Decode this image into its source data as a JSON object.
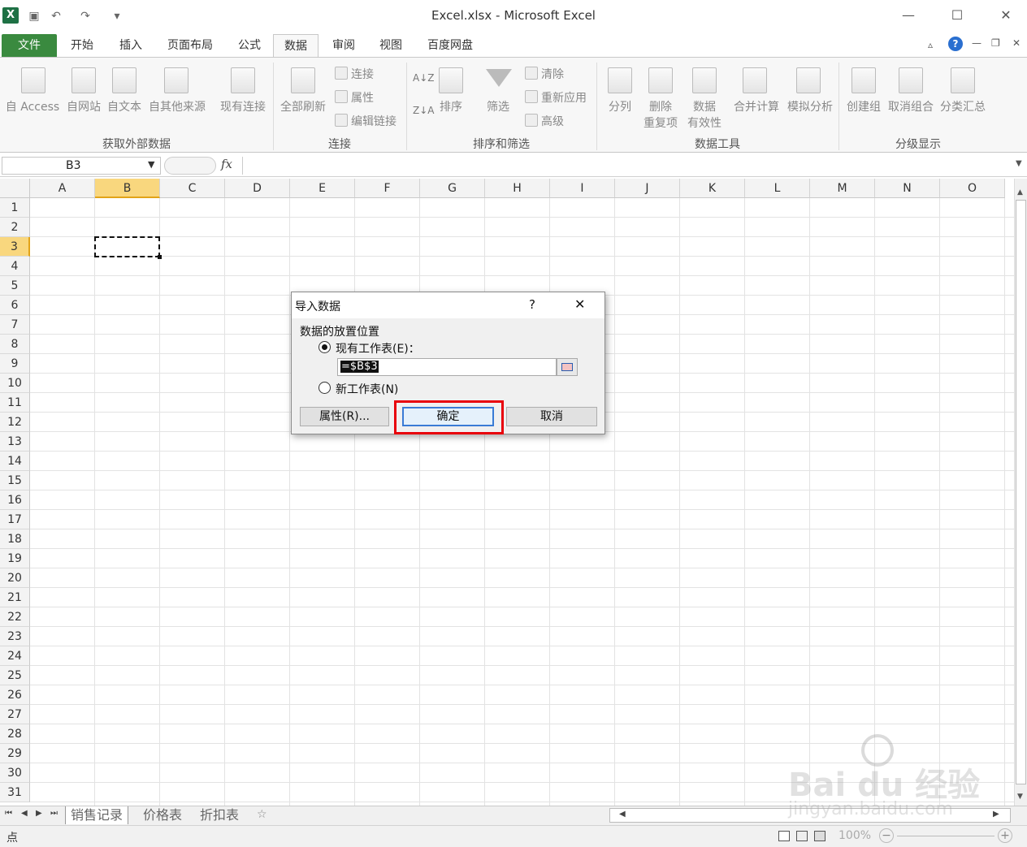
{
  "window": {
    "title": "Excel.xlsx - Microsoft Excel"
  },
  "quick_access": [
    "save-icon",
    "undo-icon",
    "redo-icon",
    "customize-icon"
  ],
  "tabs": [
    "文件",
    "开始",
    "插入",
    "页面布局",
    "公式",
    "数据",
    "审阅",
    "视图",
    "百度网盘"
  ],
  "active_tab": "数据",
  "ribbon": {
    "groups": [
      {
        "label": "获取外部数据",
        "buttons": [
          "自 Access",
          "自网站",
          "自文本",
          "自其他来源",
          "现有连接"
        ]
      },
      {
        "label": "连接",
        "buttons": [
          "全部刷新"
        ],
        "small": [
          "连接",
          "属性",
          "编辑链接"
        ]
      },
      {
        "label": "排序和筛选",
        "buttons": [
          "排序",
          "筛选"
        ],
        "small": [
          "清除",
          "重新应用",
          "高级"
        ]
      },
      {
        "label": "数据工具",
        "buttons": [
          "分列",
          "删除",
          "重复项",
          "数据",
          "有效性",
          "合并计算",
          "模拟分析"
        ]
      },
      {
        "label": "分级显示",
        "buttons": [
          "创建组",
          "取消组合",
          "分类汇总"
        ]
      }
    ]
  },
  "formula_bar": {
    "name_box": "B3",
    "fx": "fx"
  },
  "grid": {
    "columns": [
      "A",
      "B",
      "C",
      "D",
      "E",
      "F",
      "G",
      "H",
      "I",
      "J",
      "K",
      "L",
      "M",
      "N",
      "O"
    ],
    "rows": [
      "1",
      "2",
      "3",
      "4",
      "5",
      "6",
      "7",
      "8",
      "9",
      "10",
      "11",
      "12",
      "13",
      "14",
      "15",
      "16",
      "17",
      "18",
      "19",
      "20",
      "21",
      "22",
      "23",
      "24",
      "25",
      "26",
      "27",
      "28",
      "29",
      "30",
      "31"
    ],
    "selected_cell": "B3"
  },
  "sheets": [
    "销售记录",
    "价格表",
    "折扣表"
  ],
  "status": {
    "mode": "点",
    "zoom": "100%"
  },
  "dialog": {
    "title": "导入数据",
    "help": "?",
    "section_label": "数据的放置位置",
    "option_existing": "现有工作表(E)：",
    "option_new": "新工作表(N)",
    "range_value": "=$B$3",
    "properties_button": "属性(R)...",
    "ok_button": "确定",
    "cancel_button": "取消",
    "highlight_color": "#e8000b"
  },
  "watermark": {
    "brand": "Bai du 经验",
    "url": "jingyan.baidu.com"
  }
}
